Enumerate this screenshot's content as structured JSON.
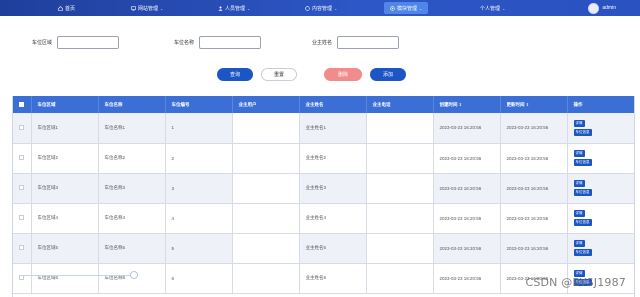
{
  "nav": {
    "items": [
      {
        "label": "首页",
        "icon": "home-icon"
      },
      {
        "label": "网站管理",
        "icon": "monitor-icon"
      },
      {
        "label": "人员管理",
        "icon": "person-icon"
      },
      {
        "label": "内容管理",
        "icon": "content-icon"
      },
      {
        "label": "模块管理",
        "icon": "module-icon"
      },
      {
        "label": "个人管理",
        "icon": "user-icon"
      }
    ],
    "user": "admin"
  },
  "search": {
    "fields": [
      {
        "label": "车位区域",
        "value": ""
      },
      {
        "label": "车位名称",
        "value": ""
      },
      {
        "label": "业主姓名",
        "value": ""
      }
    ],
    "buttons": {
      "query": "查询",
      "reset": "重置",
      "delete": "删除",
      "add": "添加"
    }
  },
  "table": {
    "headers": [
      "车位区域",
      "车位名称",
      "车位编号",
      "业主用户",
      "业主姓名",
      "业主电话",
      "创建时间",
      "更新时间",
      "操作"
    ],
    "rows": [
      [
        "车位区域1",
        "车位名称1",
        "1",
        "",
        "业主姓名1",
        "",
        "2023-03-23 16:20:56",
        "2023-03-23 16:20:56"
      ],
      [
        "车位区域2",
        "车位名称2",
        "2",
        "",
        "业主姓名2",
        "",
        "2023-03-23 16:20:56",
        "2023-03-23 16:20:56"
      ],
      [
        "车位区域3",
        "车位名称3",
        "3",
        "",
        "业主姓名3",
        "",
        "2023-03-23 16:20:56",
        "2023-03-23 16:20:56"
      ],
      [
        "车位区域4",
        "车位名称4",
        "4",
        "",
        "业主姓名4",
        "",
        "2023-03-23 16:20:56",
        "2023-03-23 16:20:56"
      ],
      [
        "车位区域5",
        "车位名称5",
        "5",
        "",
        "业主姓名5",
        "",
        "2023-03-23 16:20:56",
        "2023-03-23 16:20:56"
      ],
      [
        "车位区域6",
        "车位名称6",
        "6",
        "",
        "业主姓名6",
        "",
        "2023-03-23 16:20:56",
        "2023-03-23 16:20:56"
      ]
    ],
    "actions": {
      "detail": "详情",
      "edit": "车位信息"
    }
  },
  "watermark": "CSDN @BYSJ1987",
  "colors": {
    "nav": "#2a52c0",
    "primary": "#1c56c4",
    "danger": "#f28b8b",
    "header": "#3b6fd6"
  }
}
